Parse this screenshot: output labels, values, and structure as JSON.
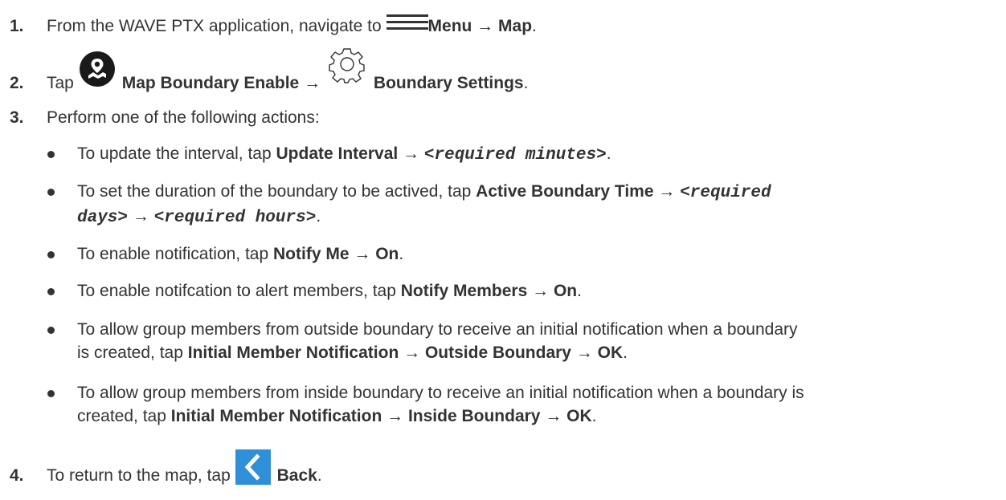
{
  "steps": [
    {
      "number": "1.",
      "prefix": "From the WAVE PTX application, navigate to ",
      "menu_label": "Menu",
      "arrow": "→",
      "map_label": "Map",
      "suffix": ".",
      "icon": "hamburger-menu-icon"
    },
    {
      "number": "2.",
      "prefix": "Tap ",
      "enable_label": "Map Boundary Enable",
      "arrow": "→",
      "settings_label": "Boundary Settings",
      "suffix": ".",
      "icons": [
        "map-boundary-enable-icon",
        "gear-icon"
      ]
    },
    {
      "number": "3.",
      "text": "Perform one of the following actions:"
    },
    {
      "number": "4.",
      "prefix": "To return to the map, tap ",
      "back_label": "Back",
      "suffix": ".",
      "icon": "back-chevron-icon"
    }
  ],
  "bullets": [
    {
      "t1": "To update the interval, tap ",
      "b1": "Update Interval",
      "a1": " → ",
      "m1": "<required minutes>",
      "end": "."
    },
    {
      "t1": "To set the duration of the boundary to be actived, tap ",
      "b1": "Active Boundary Time",
      "a1": " → ",
      "m1": "<required",
      "m2": "days>",
      "a2": " → ",
      "m3": "<required hours>",
      "end": "."
    },
    {
      "t1": "To enable notification, tap ",
      "b1": "Notify Me",
      "a1": " → ",
      "b2": "On",
      "end": "."
    },
    {
      "t1": "To enable notifcation to alert members, tap ",
      "b1": "Notify Members",
      "a1": " → ",
      "b2": "On",
      "end": "."
    },
    {
      "t1": "To allow group members from outside boundary to receive an initial notification when a boundary",
      "t2": "is created, tap ",
      "b1": "Initial Member Notification",
      "a1": " → ",
      "b2": "Outside Boundary",
      "a2": " → ",
      "b3": "OK",
      "end": "."
    },
    {
      "t1": "To allow group members from inside boundary to receive an initial notification when a boundary is",
      "t2": "created, tap ",
      "b1": "Initial Member Notification",
      "a1": " → ",
      "b2": "Inside Boundary",
      "a2": " → ",
      "b3": "OK",
      "end": "."
    }
  ],
  "colors": {
    "text": "#333333",
    "back_icon_bg": "#2f8fd8",
    "enable_icon_bg": "#1a1a1a"
  }
}
